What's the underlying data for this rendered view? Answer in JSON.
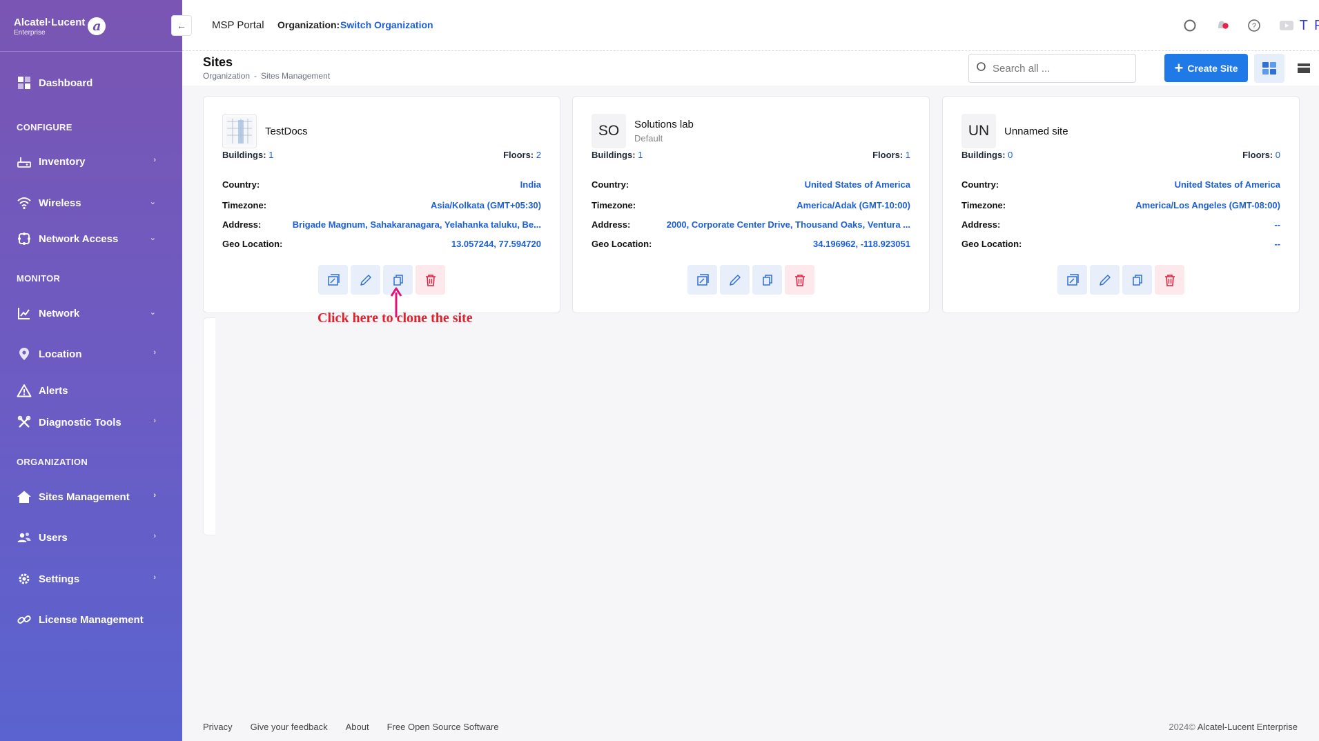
{
  "brand": {
    "name": "Alcatel·Lucent",
    "sub": "Enterprise",
    "mark": "a"
  },
  "sidebar": {
    "dashboard": "Dashboard",
    "sections": {
      "configure": "CONFIGURE",
      "monitor": "MONITOR",
      "organization": "ORGANIZATION"
    },
    "items": {
      "inventory": "Inventory",
      "wireless": "Wireless",
      "network_access": "Network Access",
      "network": "Network",
      "location": "Location",
      "alerts": "Alerts",
      "diagnostic_tools": "Diagnostic Tools",
      "sites_management": "Sites Management",
      "users": "Users",
      "settings": "Settings",
      "license_management": "License Management"
    }
  },
  "topbar": {
    "collapse_icon": "←",
    "msp": "MSP Portal",
    "org_label": "Organization:",
    "org_link": "Switch Organization",
    "avatar": "T P"
  },
  "header": {
    "title": "Sites",
    "breadcrumb": [
      "Organization",
      "-",
      "Sites Management"
    ],
    "search_placeholder": "Search all ...",
    "create_label": "Create Site"
  },
  "labels": {
    "buildings": "Buildings:",
    "floors": "Floors:",
    "country": "Country:",
    "timezone": "Timezone:",
    "address": "Address:",
    "geo": "Geo Location:"
  },
  "sites": [
    {
      "name": "TestDocs",
      "subtitle": "",
      "buildings": "1",
      "floors": "2",
      "country": "India",
      "timezone": "Asia/Kolkata (GMT+05:30)",
      "address": "Brigade Magnum, Sahakaranagara, Yelahanka taluku, Be...",
      "geo": "13.057244, 77.594720"
    },
    {
      "name": "Solutions lab",
      "initials": "SO",
      "subtitle": "Default",
      "buildings": "1",
      "floors": "1",
      "country": "United States of America",
      "timezone": "America/Adak (GMT-10:00)",
      "address": "2000, Corporate Center Drive, Thousand Oaks, Ventura ...",
      "geo": "34.196962, -118.923051"
    },
    {
      "name": "Unnamed site",
      "initials": "UN",
      "subtitle": "",
      "buildings": "0",
      "floors": "0",
      "country": "United States of America",
      "timezone": "America/Los Angeles (GMT-08:00)",
      "address": "--",
      "geo": "--"
    }
  ],
  "annotation": "Click here to clone the site",
  "footer": {
    "links": [
      "Privacy",
      "Give your feedback",
      "About",
      "Free Open Source Software"
    ],
    "year": "2024©",
    "company": "Alcatel-Lucent Enterprise"
  },
  "colors": {
    "accent": "#1f7ae8",
    "link": "#1d5fd6",
    "danger": "#e0202d",
    "annotation_arrow": "#e0127a"
  }
}
